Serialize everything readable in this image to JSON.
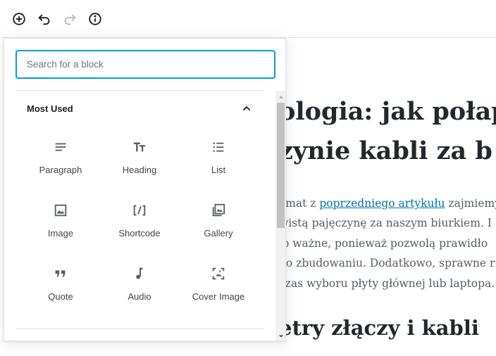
{
  "toolbar": {
    "add_icon": "plus-circle-icon",
    "undo_icon": "undo-icon",
    "redo_icon": "redo-icon",
    "info_icon": "info-icon"
  },
  "editor": {
    "title_lines": [
      "ologia: jak połap",
      "zynie kabli za b"
    ],
    "paragraph": {
      "line1_before": "emat z ",
      "line1_link": "poprzedniego artykułu",
      "line1_after": " zajmiemy",
      "line2": "wistą pajęczynę za naszym biurkiem. I",
      "line3": "ło ważne, ponieważ pozwolą prawidło",
      "line4": "go zbudowaniu. Dodatkowo, sprawne r",
      "line5": "czas wyboru płyty głównej lub laptopa."
    },
    "heading2": "etry złączy i kabli"
  },
  "inserter": {
    "search": {
      "placeholder": "Search for a block",
      "value": ""
    },
    "panel": {
      "title": "Most Used",
      "blocks": [
        {
          "label": "Paragraph",
          "icon": "paragraph-icon"
        },
        {
          "label": "Heading",
          "icon": "heading-icon"
        },
        {
          "label": "List",
          "icon": "list-icon"
        },
        {
          "label": "Image",
          "icon": "image-icon"
        },
        {
          "label": "Shortcode",
          "icon": "shortcode-icon"
        },
        {
          "label": "Gallery",
          "icon": "gallery-icon"
        },
        {
          "label": "Quote",
          "icon": "quote-icon"
        },
        {
          "label": "Audio",
          "icon": "audio-icon"
        },
        {
          "label": "Cover Image",
          "icon": "cover-image-icon"
        }
      ]
    }
  },
  "colors": {
    "accent": "#00a0d2",
    "link": "#0073aa",
    "text": "#1e1e1e"
  }
}
